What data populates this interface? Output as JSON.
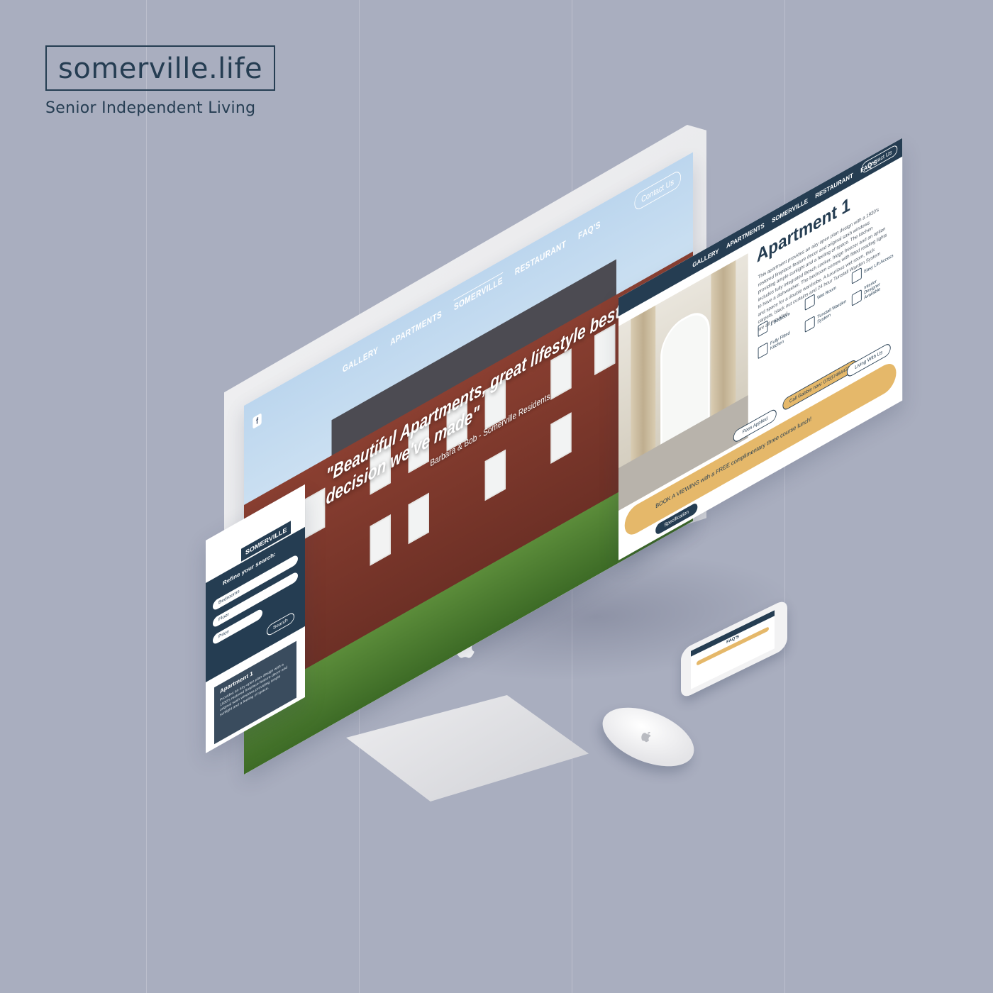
{
  "brand": {
    "site": "somerville.life",
    "tagline": "Senior Independent Living"
  },
  "main_site": {
    "nav": [
      "GALLERY",
      "APARTMENTS",
      "SOMERVILLE",
      "RESTAURANT",
      "FAQ'S"
    ],
    "contact_label": "Contact Us",
    "hero_quote": "\"Beautiful Apartments, great lifestyle best decision we've made\"",
    "hero_cite": "Barbara & Bob - Somerville Residents"
  },
  "apartment_page": {
    "nav": [
      "GALLERY",
      "APARTMENTS",
      "SOMERVILLE",
      "RESTAURANT",
      "FAQ'S"
    ],
    "contact_label": "Contact Us",
    "title": "Apartment 1",
    "description": "This apartment provides an airy open plan design with a 1930's restored fireplace feature decor and original sash windows providing ample sunlight and a feeling of space. The kitchen includes fully integrated Bosch cooker, fridge freezer and an option to have a dishwasher. The bedroom comes with fitted reading lights and space for a double wardrobe. A luxurious wet room, thick carpets, black out curtains and 24 hour Tunstall Warden System are all provided.",
    "features": [
      "1 Bedroom",
      "Wet Room",
      "Easy Lift Access",
      "Fully Fitted Kitchen",
      "Tunstall Warden System",
      "Interior Designer Available"
    ],
    "book_text": "BOOK A VIEWING with a FREE complimentary three course lunch!",
    "fees_label": "Fees Applied",
    "call_label": "Call Gabbie now: 07837484433",
    "living_label": "Living With Us",
    "spec_label": "Specification"
  },
  "mobile_page": {
    "logo": "SOMERVILLE",
    "refine": "Refine your search:",
    "fields": [
      "Bedrooms",
      "Floor",
      "Price"
    ],
    "search_label": "Search",
    "card_title": "Apartment 1",
    "card_text": "Provides an airy open plan design with a 1930's restored fireplace feature decor and original sash windows providing ample sunlight and a feeling of space."
  },
  "phone_page": {
    "title": "FAQ'S"
  },
  "colors": {
    "navy": "#253d52",
    "gold": "#e5b86a",
    "background": "#a9aebf"
  }
}
